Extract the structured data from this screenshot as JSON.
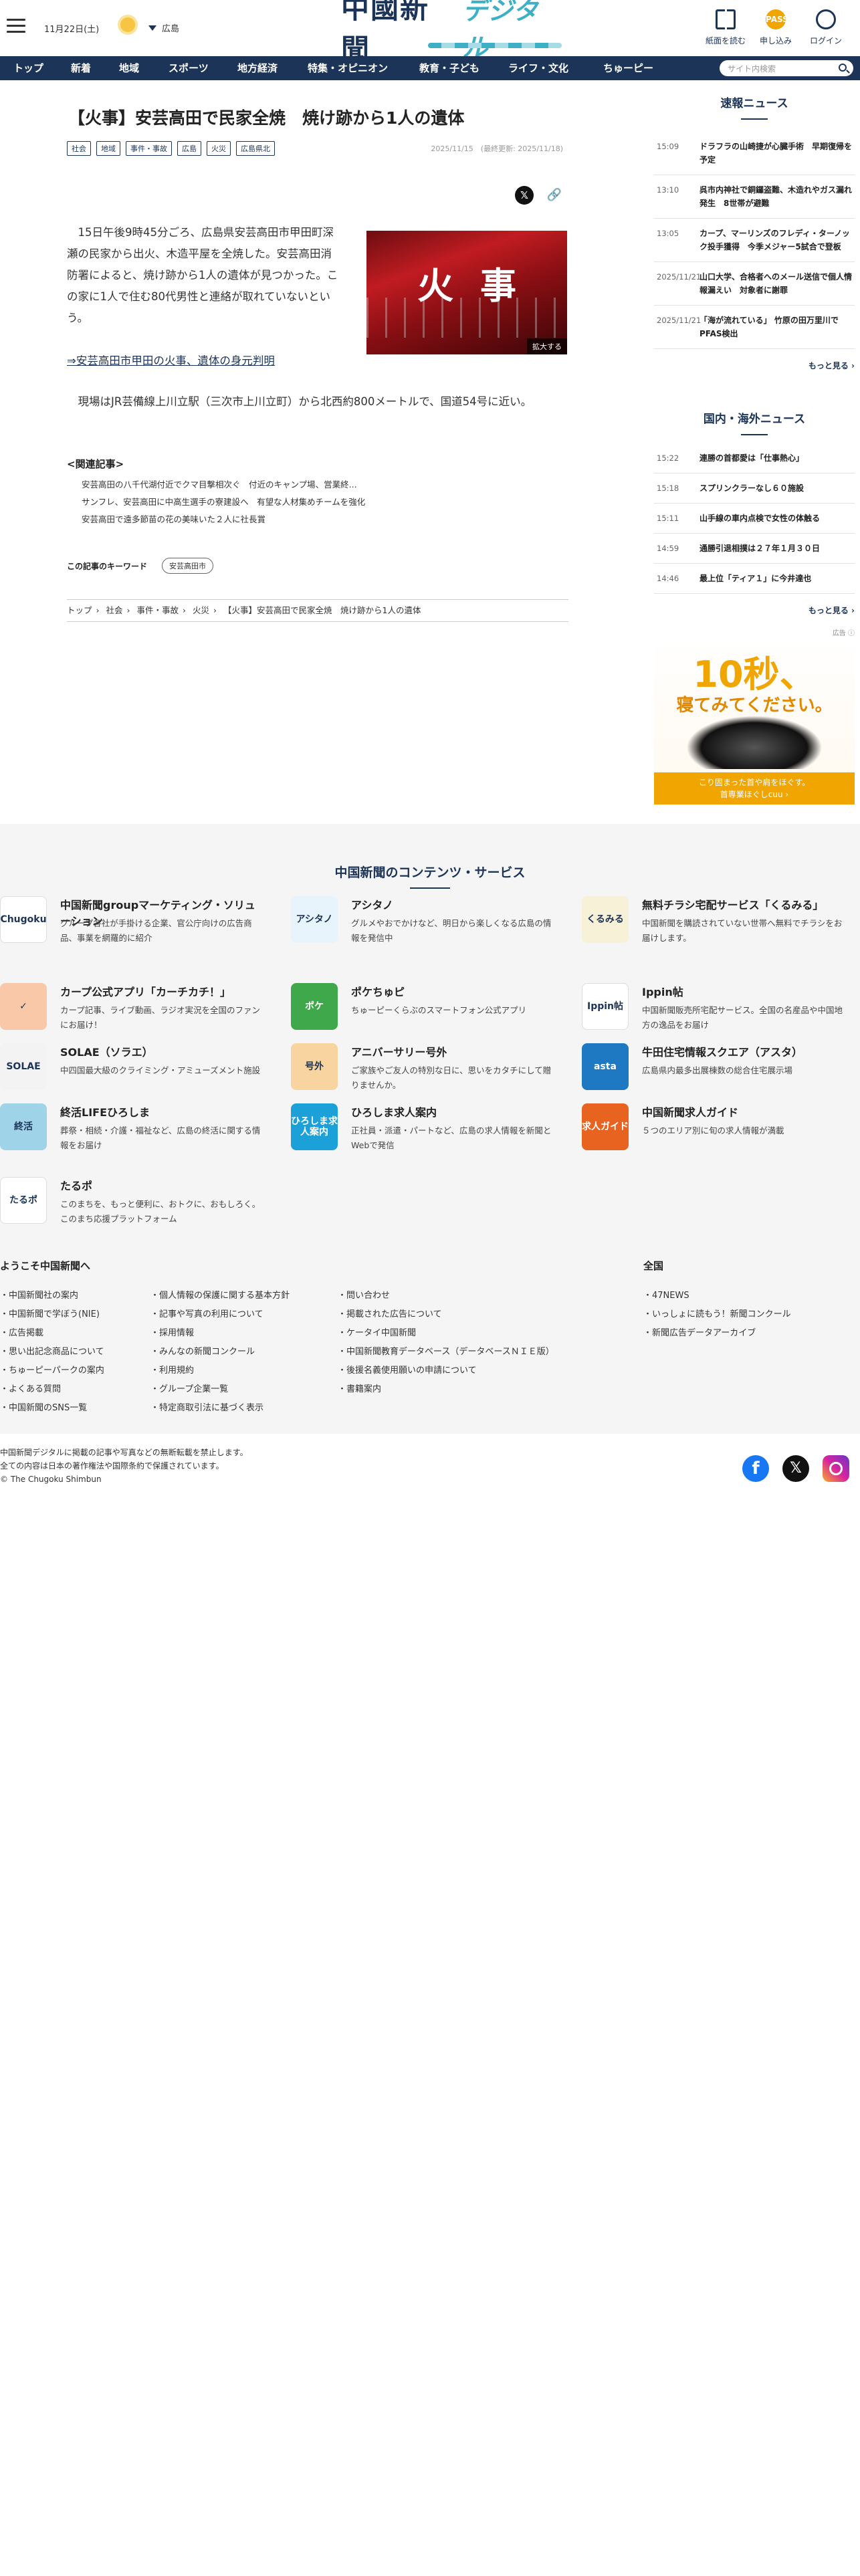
{
  "header": {
    "date": "11月22日(土)",
    "region": "広島",
    "logo_main": "中國新聞",
    "logo_sub": "デジタル",
    "btn_paper": "紙面を読む",
    "btn_apply": "申し込み",
    "btn_apply_icon": "PASS",
    "btn_login": "ログイン"
  },
  "nav": {
    "items": [
      "トップ",
      "新着",
      "地域",
      "スポーツ",
      "地方経済",
      "特集・オピニオン",
      "教育・子ども",
      "ライフ・文化",
      "ちゅーピー"
    ],
    "search_placeholder": "サイト内検索"
  },
  "article": {
    "title": "【火事】安芸高田で民家全焼　焼け跡から1人の遺体",
    "tags": [
      "社会",
      "地域",
      "事件・事故",
      "広島",
      "火災",
      "広島県北"
    ],
    "date": "2025/11/15　(最終更新: 2025/11/18)",
    "body": "　15日午後9時45分ごろ、広島県安芸高田市甲田町深瀬の民家から出火、木造平屋を全焼した。安芸高田消防署によると、焼け跡から1人の遺体が見つかった。この家に1人で住む80代男性と連絡が取れていないという。",
    "photo_text": "火事",
    "photo_zoom": "拡大する",
    "link": "⇒安芸高田市甲田の火事、遺体の身元判明",
    "para2": "　現場はJR芸備線上川立駅（三次市上川立町）から北西約800メートルで、国道54号に近い。",
    "related_title": "<関連記事>",
    "related": [
      "安芸高田の八千代湖付近でクマ目撃相次ぐ　付近のキャンプ場、営業終...",
      "サンフレ、安芸高田に中高生選手の寮建設へ　有望な人材集めチームを強化",
      "安芸高田で遠多節苗の花の美味いた２人に社長賞"
    ],
    "keyword_label": "この記事のキーワード",
    "keyword": "安芸高田市",
    "breadcrumb": [
      "トップ",
      "社会",
      "事件・事故",
      "火災",
      "【火事】安芸高田で民家全焼　焼け跡から1人の遺体"
    ]
  },
  "sidebar": {
    "breaking_title": "速報ニュース",
    "breaking": [
      {
        "time": "15:09",
        "headline": "ドラフラの山崎捷が心臓手術　早期復帰を予定"
      },
      {
        "time": "13:10",
        "headline": "呉市内神社で銅鑼盗難、木造れやガス漏れ発生　8世帯が避難"
      },
      {
        "time": "13:05",
        "headline": "カープ、マーリンズのフレディ・ターノック投手獲得　今季メジャー5試合で登板"
      },
      {
        "time": "2025/11/21",
        "headline": "山口大学、合格者へのメール送信で個人情報漏えい　対象者に謝罪"
      },
      {
        "time": "2025/11/21",
        "headline": "「海が流れている」 竹原の田万里川でPFAS検出"
      }
    ],
    "more1": "もっと見る",
    "national_title": "国内・海外ニュース",
    "national": [
      {
        "time": "15:22",
        "headline": "連勝の首都愛は「仕事熱心」"
      },
      {
        "time": "15:18",
        "headline": "スプリンクラーなし６０施設"
      },
      {
        "time": "15:11",
        "headline": "山手線の車内点検で女性の体触る"
      },
      {
        "time": "14:59",
        "headline": "通勝引退相撲は２７年１月３０日"
      },
      {
        "time": "14:46",
        "headline": "最上位「ティア１」に今井達也"
      }
    ],
    "more2": "もっと見る",
    "ad_label": "広告 ⓘ",
    "ad_line1": "10秒、",
    "ad_line2": "寝てみてください。",
    "ad_bar1": "こり固まった首や肩をほぐす。",
    "ad_bar2": "首専業ほぐしcuu ›"
  },
  "footer": {
    "services_title": "中国新聞のコンテンツ・サービス",
    "services": [
      {
        "name": "中国新聞groupマーケティング・ソリューション",
        "desc": "グループ各社が手掛ける企業、官公庁向けの広告商品、事業を網羅的に紹介",
        "logo": "Chugoku",
        "color": "#ffffff"
      },
      {
        "name": "アシタノ",
        "desc": "グルメやおでかけなど、明日から楽しくなる広島の情報を発信中",
        "logo": "アシタノ",
        "color": "#e8f4fb"
      },
      {
        "name": "無料チラシ宅配サービス「くるみる」",
        "desc": "中国新聞を購読されていない世帯へ無料でチラシをお届けします。",
        "logo": "くるみる",
        "color": "#f7f1d8"
      },
      {
        "name": "カープ公式アプリ「カーチカチ！」",
        "desc": "カープ記事、ライブ動画、ラジオ実況を全国のファンにお届け！",
        "logo": "✓",
        "color": "#f9c8a8"
      },
      {
        "name": "ポケちゅピ",
        "desc": "ちゅーピーくらぶのスマートフォン公式アプリ",
        "logo": "ポケ",
        "color": "#3fa84a"
      },
      {
        "name": "Ippin帖",
        "desc": "中国新聞販売所宅配サービス。全国の名産品や中国地方の逸品をお届け",
        "logo": "Ippin帖",
        "color": "#ffffff"
      },
      {
        "name": "SOLAE（ソラエ）",
        "desc": "中四国最大級のクライミング・アミューズメント施設",
        "logo": "SOLAE",
        "color": "#f3f3f3"
      },
      {
        "name": "アニバーサリー号外",
        "desc": "ご家族やご友人の特別な日に、思いをカタチにして贈りませんか。",
        "logo": "号外",
        "color": "#f7d4a0"
      },
      {
        "name": "牛田住宅情報スクエア（アスタ）",
        "desc": "広島県内最多出展棟数の総合住宅展示場",
        "logo": "asta",
        "color": "#1f79c2"
      },
      {
        "name": "終活LIFEひろしま",
        "desc": "葬祭・相続・介護・福祉など、広島の終活に関する情報をお届け",
        "logo": "終活",
        "color": "#9fd3e8"
      },
      {
        "name": "ひろしま求人案内",
        "desc": "正社員・派遣・パートなど、広島の求人情報を新聞とWebで発信",
        "logo": "ひろしま求人案内",
        "color": "#1ba0d8"
      },
      {
        "name": "中国新聞求人ガイド",
        "desc": "５つのエリア別に旬の求人情報が満載",
        "logo": "求人ガイド",
        "color": "#e8631f"
      },
      {
        "name": "たるポ",
        "desc": "このまちを、もっと便利に、おトクに、おもしろく。このまち応援プラットフォーム",
        "logo": "たるポ",
        "color": "#ffffff"
      }
    ],
    "welcome_title": "ようこそ中国新聞へ",
    "col1": [
      "中国新聞社の案内",
      "中国新聞で学ぼう(NIE)",
      "広告掲載",
      "思い出記念商品について",
      "ちゅーピーパークの案内",
      "よくある質問",
      "中国新聞のSNS一覧"
    ],
    "col2": [
      "個人情報の保護に関する基本方針",
      "記事や写真の利用について",
      "採用情報",
      "みんなの新聞コンクール",
      "利用規約",
      "グループ企業一覧",
      "特定商取引法に基づく表示"
    ],
    "col3": [
      "問い合わせ",
      "掲載された広告について",
      "ケータイ中国新聞",
      "中国新聞教育データベース（データベースＮＩＥ版）",
      "後援名義使用願いの申請について",
      "書籍案内"
    ],
    "national_title": "全国",
    "col4": [
      "47NEWS",
      "いっしょに読もう！新聞コンクール",
      "新聞広告データアーカイブ"
    ],
    "copy1": "中国新聞デジタルに掲載の記事や写真などの無断転載を禁止します。",
    "copy2": "全ての内容は日本の著作権法や国際条約で保護されています。",
    "copy3": "© The Chugoku Shimbun",
    "colors": {
      "navy": "#1c3458",
      "accent": "#f0a500",
      "facebook": "#1877f2",
      "x": "#111111",
      "instagram": "#d6249f"
    }
  }
}
